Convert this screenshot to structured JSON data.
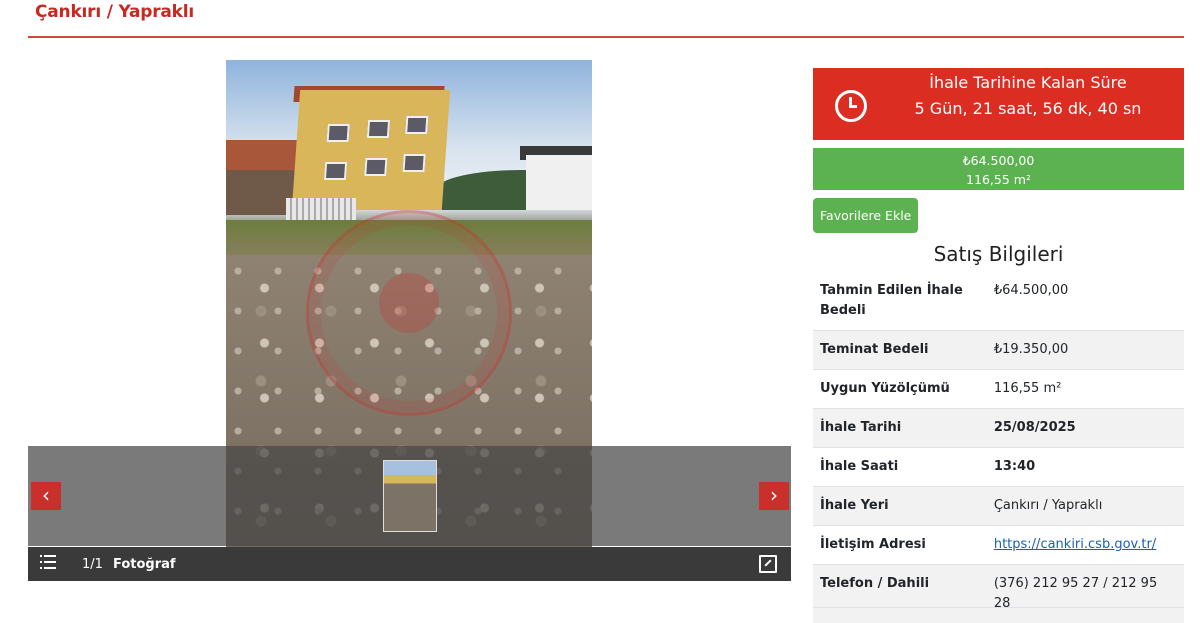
{
  "header": {
    "title": "Çankırı / Yapraklı"
  },
  "gallery": {
    "counter": "1/1",
    "label": "Fotoğraf",
    "prev_icon": "chevron-left-icon",
    "next_icon": "chevron-right-icon",
    "prev_glyph": "‹",
    "next_glyph": "›"
  },
  "countdown": {
    "title": "İhale Tarihine Kalan Süre",
    "time": "5 Gün, 21 saat, 56 dk, 40 sn"
  },
  "price_box": {
    "price": "₺64.500,00",
    "area": "116,55 m²"
  },
  "favorite_button": "Favorilere Ekle",
  "sales": {
    "title": "Satış Bilgileri",
    "rows": [
      {
        "key": "Tahmin Edilen İhale Bedeli",
        "value": "₺64.500,00"
      },
      {
        "key": "Teminat Bedeli",
        "value": "₺19.350,00"
      },
      {
        "key": "Uygun Yüzölçümü",
        "value": "116,55 m²"
      },
      {
        "key": "İhale Tarihi",
        "value": "25/08/2025"
      },
      {
        "key": "İhale Saati",
        "value": "13:40"
      },
      {
        "key": "İhale Yeri",
        "value": "Çankırı / Yapraklı"
      },
      {
        "key": "İletişim Adresi",
        "value": "https://cankiri.csb.gov.tr/"
      },
      {
        "key": "Telefon / Dahili",
        "value": "(376) 212 95 27 / 212 95 28"
      }
    ]
  },
  "colors": {
    "accent_red": "#dc2d22",
    "accent_green": "#5cb150",
    "link": "#1a5fb4"
  }
}
